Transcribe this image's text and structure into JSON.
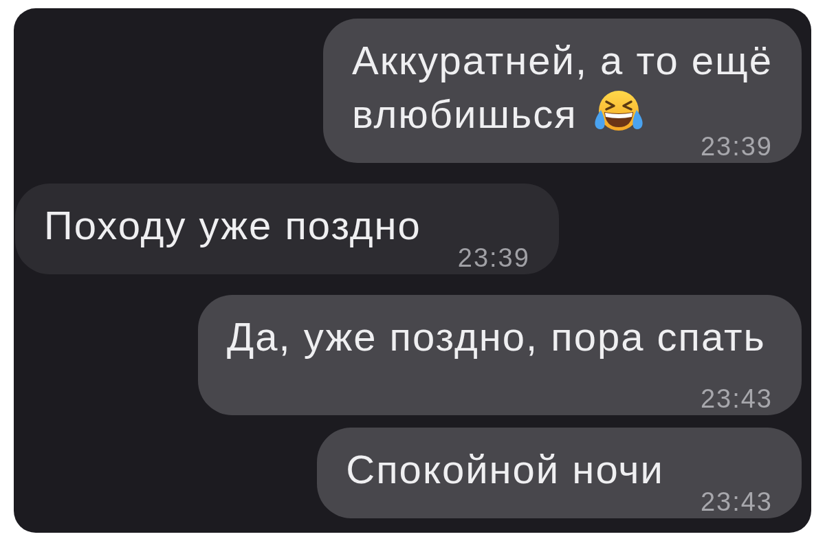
{
  "messages": [
    {
      "kind": "sent",
      "text": "Аккуратней, а то ещё\nвлюбишься",
      "trailing_emoji": true,
      "time": "23:39"
    },
    {
      "kind": "received",
      "text": "Походу уже поздно",
      "trailing_emoji": false,
      "time": "23:39"
    },
    {
      "kind": "sent",
      "text": "Да, уже поздно, пора спать",
      "trailing_emoji": false,
      "time": "23:43"
    },
    {
      "kind": "sent",
      "text": "Спокойной ночи",
      "trailing_emoji": false,
      "time": "23:43"
    }
  ]
}
